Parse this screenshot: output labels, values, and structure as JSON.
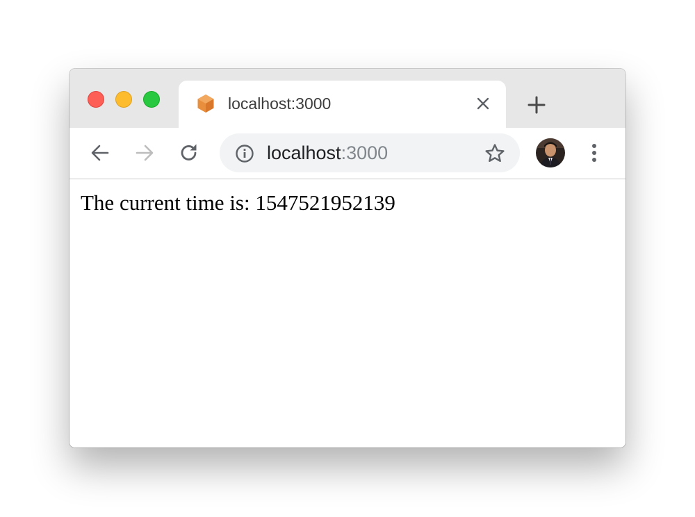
{
  "tab": {
    "title": "localhost:3000",
    "favicon": "nodejs-hexagon-icon"
  },
  "omnibox": {
    "host": "localhost",
    "port": ":3000"
  },
  "page": {
    "text": "The current time is: 1547521952139"
  },
  "colors": {
    "close": "#fd5f57",
    "minimize": "#fdbc2e",
    "maximize": "#28c840",
    "favicon": "#e88f3e",
    "icon_gray": "#5f6368",
    "icon_disabled": "#bdbdbd"
  }
}
